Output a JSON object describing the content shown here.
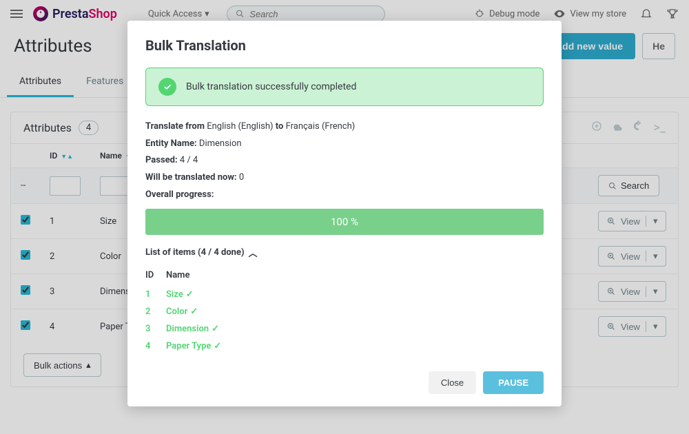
{
  "topbar": {
    "logo_presta": "Presta",
    "logo_shop": "Shop",
    "quick_access": "Quick Access",
    "search_placeholder": "Search",
    "debug": "Debug mode",
    "view_store": "View my store"
  },
  "page": {
    "title": "Attributes",
    "btn_add": "Add new value",
    "btn_help": "He"
  },
  "tabs": [
    {
      "label": "Attributes",
      "active": true
    },
    {
      "label": "Features",
      "active": false
    }
  ],
  "panel": {
    "title": "Attributes",
    "count": "4",
    "headers": {
      "id": "ID",
      "name": "Name"
    },
    "filter_placeholder_dash": "--",
    "search_btn": "Search",
    "view_btn": "View",
    "bulk_btn": "Bulk actions",
    "rows": [
      {
        "id": "1",
        "name": "Size"
      },
      {
        "id": "2",
        "name": "Color"
      },
      {
        "id": "3",
        "name": "Dimension"
      },
      {
        "id": "4",
        "name": "Paper Type"
      }
    ]
  },
  "modal": {
    "title": "Bulk Translation",
    "alert": "Bulk translation successfully completed",
    "translate_from_label": "Translate from",
    "translate_from_value": "English (English)",
    "translate_to_label": "to",
    "translate_to_value": "Français (French)",
    "entity_label": "Entity Name:",
    "entity_value": "Dimension",
    "passed_label": "Passed:",
    "passed_value": "4 / 4",
    "willbe_label": "Will be translated now:",
    "willbe_value": "0",
    "overall_label": "Overall progress:",
    "progress": "100 %",
    "list_label": "List of items (4 / 4 done)",
    "list_headers": {
      "id": "ID",
      "name": "Name"
    },
    "items": [
      {
        "id": "1",
        "name": "Size"
      },
      {
        "id": "2",
        "name": "Color"
      },
      {
        "id": "3",
        "name": "Dimension"
      },
      {
        "id": "4",
        "name": "Paper Type"
      }
    ],
    "close_btn": "Close",
    "pause_btn": "PAUSE"
  }
}
